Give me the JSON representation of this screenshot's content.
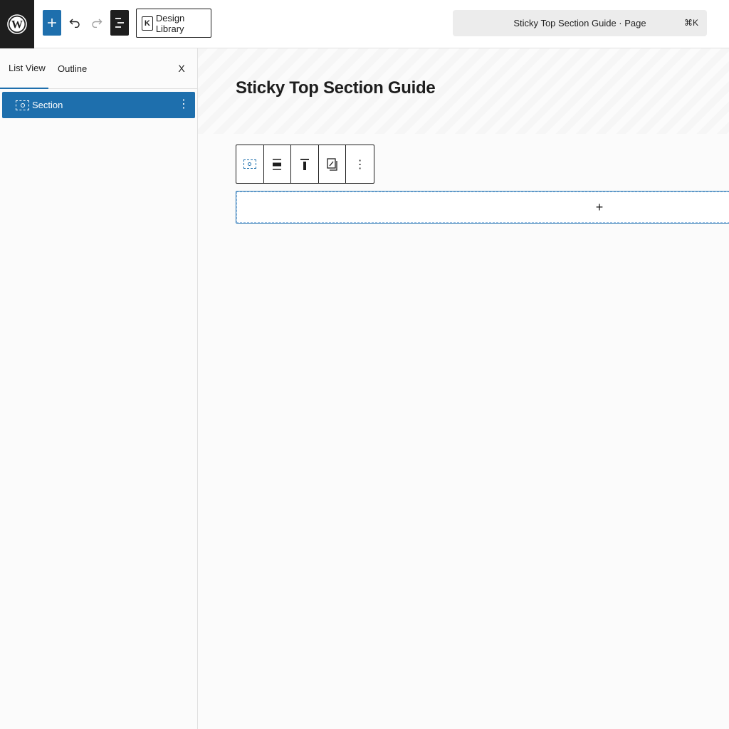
{
  "topbar": {
    "logo_icon": "wordpress-logo-icon",
    "add_block_icon": "plus-icon",
    "undo_icon": "undo-icon",
    "redo_icon": "redo-icon",
    "list_view_icon": "document-overview-icon",
    "design_library_label": "Design Library",
    "design_library_icon": "kadence-icon",
    "design_library_icon_glyph": "K",
    "command_bar_text": "Sticky Top Section Guide · Page",
    "command_shortcut": "⌘K"
  },
  "sidebar": {
    "tabs": [
      {
        "label": "List View",
        "active": true
      },
      {
        "label": "Outline",
        "active": false
      }
    ],
    "close_label": "X",
    "items": [
      {
        "label": "Section",
        "icon": "section-icon",
        "selected": true,
        "more": "⋮"
      }
    ]
  },
  "canvas": {
    "title": "Sticky Top Section Guide",
    "block_toolbar": {
      "buttons": [
        "section-icon",
        "align-center-icon",
        "align-top-icon",
        "copy-styles-icon",
        "more-options-icon"
      ],
      "more_glyph": "⋮"
    },
    "appender_glyph": "+"
  },
  "colors": {
    "accent": "#1e6fad",
    "dark": "#1e1e1e",
    "background": "#fbfbfb",
    "command_bar_bg": "#ececec"
  }
}
